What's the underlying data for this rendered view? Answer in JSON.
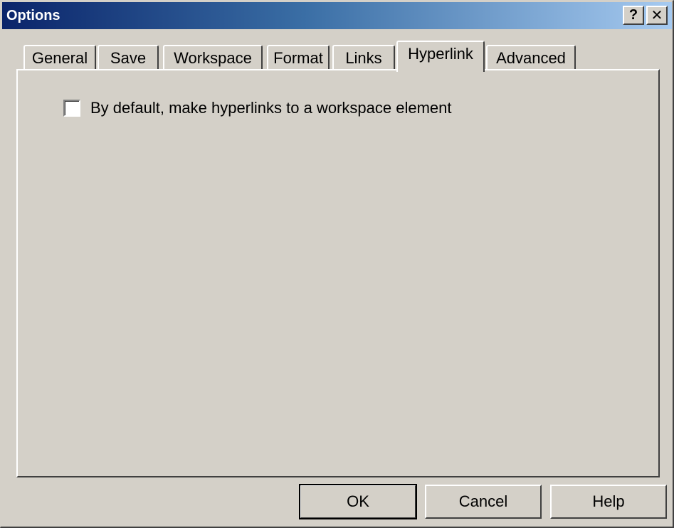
{
  "window": {
    "title": "Options",
    "help_glyph": "?",
    "close_glyph": "✕"
  },
  "tabs": [
    {
      "label": "General",
      "active": false
    },
    {
      "label": "Save",
      "active": false
    },
    {
      "label": "Workspace",
      "active": false
    },
    {
      "label": "Format",
      "active": false
    },
    {
      "label": "Links",
      "active": false
    },
    {
      "label": "Hyperlink",
      "active": true
    },
    {
      "label": "Advanced",
      "active": false
    }
  ],
  "hyperlink_panel": {
    "checkbox_label": "By default, make hyperlinks to a workspace element",
    "checked": false
  },
  "buttons": {
    "ok": "OK",
    "cancel": "Cancel",
    "help": "Help"
  },
  "colors": {
    "face": "#d4d0c8",
    "title_start": "#0a246a",
    "title_end": "#a6caf0"
  }
}
